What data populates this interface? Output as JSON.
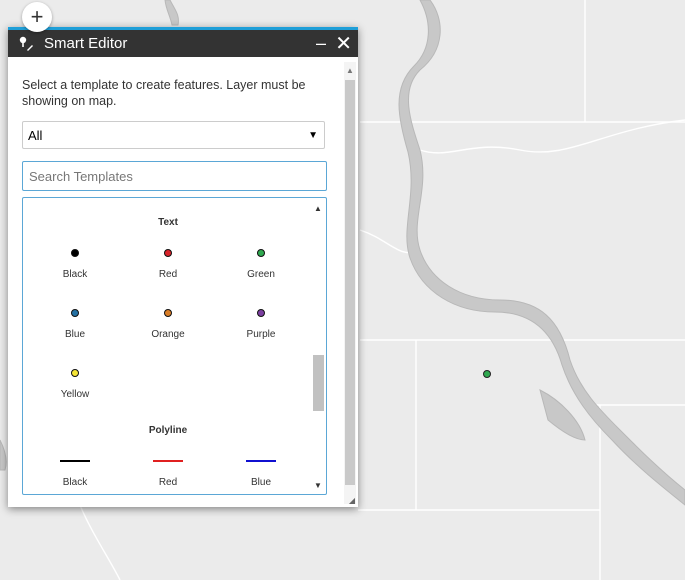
{
  "map": {
    "zoom_in_label": "+"
  },
  "panel": {
    "title": "Smart Editor",
    "minimize_label": "–",
    "close_label": "✕",
    "description": "Select a template to create features. Layer must be showing on map.",
    "filter_value": "All",
    "search_placeholder": "Search Templates"
  },
  "groups": [
    {
      "title": "Text",
      "items": [
        {
          "label": "Black",
          "color": "#000000"
        },
        {
          "label": "Red",
          "color": "#d8232a"
        },
        {
          "label": "Green",
          "color": "#2fa84f"
        },
        {
          "label": "Blue",
          "color": "#2471a3"
        },
        {
          "label": "Orange",
          "color": "#d97d26"
        },
        {
          "label": "Purple",
          "color": "#7b3fa0"
        },
        {
          "label": "Yellow",
          "color": "#f5e536"
        }
      ]
    },
    {
      "title": "Polyline",
      "items": [
        {
          "label": "Black",
          "color": "#000000"
        },
        {
          "label": "Red",
          "color": "#e02020"
        },
        {
          "label": "Blue",
          "color": "#1010d0"
        }
      ]
    }
  ],
  "colors": {
    "accent": "#1f9fd8",
    "titlebar": "#333333"
  }
}
